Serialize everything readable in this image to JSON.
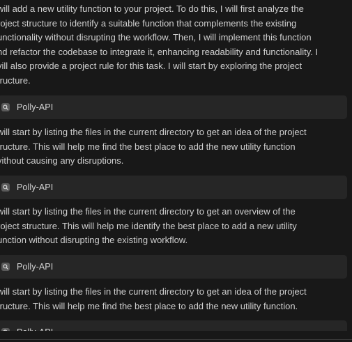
{
  "messages": [
    {
      "lines": [
        "will add a new utility function to your project. To do this, I will first analyze the",
        "roject structure to identify a suitable function that complements the existing",
        "unctionality without disrupting the workflow. Then, I will implement this function",
        "nd refactor the codebase to integrate it, enhancing readability and functionality. I",
        "vill also provide a project rule for this task. I will start by exploring the project",
        "tructure."
      ]
    },
    {
      "lines": [
        "will start by listing the files in the current directory to get an idea of the project",
        "tructure. This will help me find the best place to add the new utility function",
        "vithout causing any disruptions."
      ]
    },
    {
      "lines": [
        "will start by listing the files in the current directory to get an overview of the",
        "roject structure. This will help me identify the best place to add a new utility",
        "unction without disrupting the existing workflow."
      ]
    },
    {
      "lines": [
        "will start by listing the files in the current directory to get an idea of the project",
        "tructure. This will help me find the best place to add the new utility function."
      ]
    }
  ],
  "tool_calls": [
    {
      "label": "Polly-API",
      "icon": "search-icon"
    },
    {
      "label": "Polly-API",
      "icon": "search-icon"
    },
    {
      "label": "Polly-API",
      "icon": "search-icon"
    },
    {
      "label": "Polly-API",
      "icon": "search-icon"
    }
  ],
  "colors": {
    "background": "#181818",
    "chip_background": "#262626",
    "text": "#cfcfcf",
    "icon_badge": "#5a5a5a"
  }
}
